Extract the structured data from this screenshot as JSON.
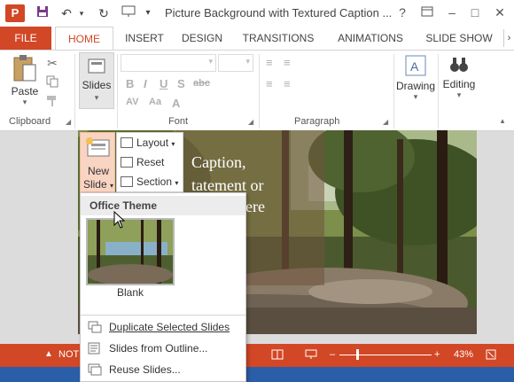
{
  "app": {
    "title": "Picture Background with Textured Caption ...",
    "logo_letter": "P",
    "accent": "#d24726"
  },
  "qat": {
    "save_icon": "save-icon",
    "undo_icon": "undo-icon",
    "redo_icon": "redo-icon"
  },
  "window": {
    "help": "?",
    "restore_ribbon": "ribbon-display-icon",
    "minimize": "–",
    "maximize": "□",
    "close": "✕"
  },
  "tabs": [
    {
      "label": "FILE"
    },
    {
      "label": "HOME"
    },
    {
      "label": "INSERT"
    },
    {
      "label": "DESIGN"
    },
    {
      "label": "TRANSITIONS"
    },
    {
      "label": "ANIMATIONS"
    },
    {
      "label": "SLIDE SHOW"
    }
  ],
  "ribbon": {
    "groups": [
      {
        "label": "Clipboard"
      },
      {
        "label": "Font"
      },
      {
        "label": "Paragraph"
      }
    ],
    "paste": "Paste",
    "slides": "Slides",
    "drawing": "Drawing",
    "editing": "Editing",
    "font_buttons": [
      "B",
      "I",
      "U",
      "S",
      "abc",
      "AV",
      "Aa",
      "A"
    ],
    "para_buttons": [
      "≡",
      "≡",
      "≡",
      "≡"
    ]
  },
  "slide": {
    "caption_lines": [
      "Caption,",
      "tatement or",
      "here"
    ]
  },
  "new_slide": {
    "line1": "New",
    "line2": "Slide",
    "commands": [
      {
        "label": "Layout"
      },
      {
        "label": "Reset"
      },
      {
        "label": "Section"
      }
    ]
  },
  "dropdown": {
    "header": "Office Theme",
    "layout_name": "Blank",
    "items": [
      {
        "label": "Duplicate Selected Slides"
      },
      {
        "label": "Slides from Outline..."
      },
      {
        "label": "Reuse Slides..."
      }
    ]
  },
  "statusbar": {
    "notes": "NOT",
    "zoom": "43%",
    "minus": "–",
    "plus": "+"
  }
}
